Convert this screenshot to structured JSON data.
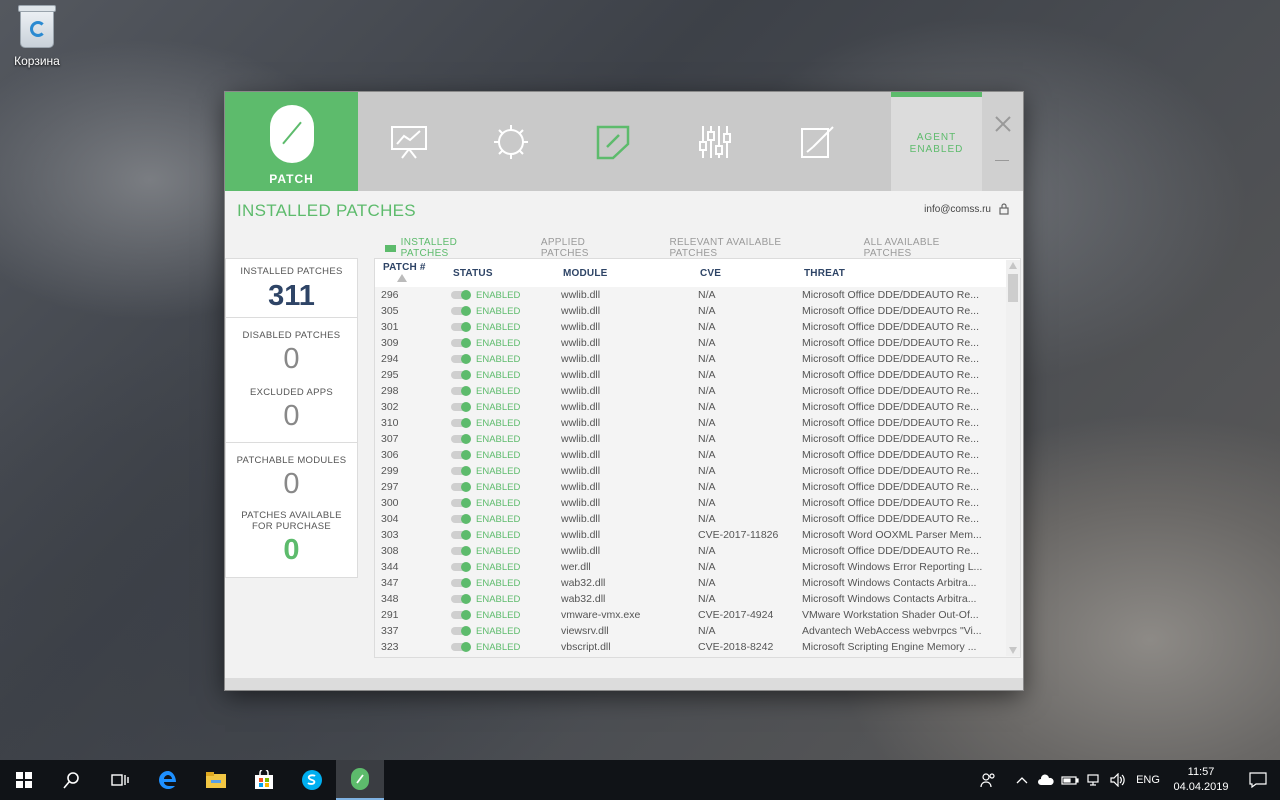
{
  "desktop": {
    "recycle_bin_label": "Корзина"
  },
  "app": {
    "logo_text": "PATCH",
    "agent_status_line1": "AGENT",
    "agent_status_line2": "ENABLED",
    "page_title": "INSTALLED PATCHES",
    "user_email": "info@comss.ru",
    "accent_color": "#5dbb6c",
    "nav_icons": [
      "dashboard-icon",
      "settings-gear-icon",
      "patch-shield-icon",
      "sliders-icon",
      "edit-icon"
    ],
    "tabs": [
      "INSTALLED PATCHES",
      "APPLIED PATCHES",
      "RELEVANT AVAILABLE PATCHES",
      "ALL AVAILABLE PATCHES"
    ],
    "active_tab": "INSTALLED PATCHES"
  },
  "stats": {
    "installed_label": "INSTALLED PATCHES",
    "installed_value": "311",
    "disabled_label": "DISABLED PATCHES",
    "disabled_value": "0",
    "excluded_label": "EXCLUDED APPS",
    "excluded_value": "0",
    "modules_label": "PATCHABLE MODULES",
    "modules_value": "0",
    "purchase_label_1": "PATCHES AVAILABLE",
    "purchase_label_2": "FOR PURCHASE",
    "purchase_value": "0"
  },
  "table": {
    "headers": [
      "PATCH #",
      "STATUS",
      "MODULE",
      "CVE",
      "THREAT"
    ],
    "rows": [
      [
        "296",
        "ENABLED",
        "wwlib.dll",
        "N/A",
        "Microsoft Office DDE/DDEAUTO Re..."
      ],
      [
        "305",
        "ENABLED",
        "wwlib.dll",
        "N/A",
        "Microsoft Office DDE/DDEAUTO Re..."
      ],
      [
        "301",
        "ENABLED",
        "wwlib.dll",
        "N/A",
        "Microsoft Office DDE/DDEAUTO Re..."
      ],
      [
        "309",
        "ENABLED",
        "wwlib.dll",
        "N/A",
        "Microsoft Office DDE/DDEAUTO Re..."
      ],
      [
        "294",
        "ENABLED",
        "wwlib.dll",
        "N/A",
        "Microsoft Office DDE/DDEAUTO Re..."
      ],
      [
        "295",
        "ENABLED",
        "wwlib.dll",
        "N/A",
        "Microsoft Office DDE/DDEAUTO Re..."
      ],
      [
        "298",
        "ENABLED",
        "wwlib.dll",
        "N/A",
        "Microsoft Office DDE/DDEAUTO Re..."
      ],
      [
        "302",
        "ENABLED",
        "wwlib.dll",
        "N/A",
        "Microsoft Office DDE/DDEAUTO Re..."
      ],
      [
        "310",
        "ENABLED",
        "wwlib.dll",
        "N/A",
        "Microsoft Office DDE/DDEAUTO Re..."
      ],
      [
        "307",
        "ENABLED",
        "wwlib.dll",
        "N/A",
        "Microsoft Office DDE/DDEAUTO Re..."
      ],
      [
        "306",
        "ENABLED",
        "wwlib.dll",
        "N/A",
        "Microsoft Office DDE/DDEAUTO Re..."
      ],
      [
        "299",
        "ENABLED",
        "wwlib.dll",
        "N/A",
        "Microsoft Office DDE/DDEAUTO Re..."
      ],
      [
        "297",
        "ENABLED",
        "wwlib.dll",
        "N/A",
        "Microsoft Office DDE/DDEAUTO Re..."
      ],
      [
        "300",
        "ENABLED",
        "wwlib.dll",
        "N/A",
        "Microsoft Office DDE/DDEAUTO Re..."
      ],
      [
        "304",
        "ENABLED",
        "wwlib.dll",
        "N/A",
        "Microsoft Office DDE/DDEAUTO Re..."
      ],
      [
        "303",
        "ENABLED",
        "wwlib.dll",
        "CVE-2017-11826",
        "Microsoft Word OOXML Parser Mem..."
      ],
      [
        "308",
        "ENABLED",
        "wwlib.dll",
        "N/A",
        "Microsoft Office DDE/DDEAUTO Re..."
      ],
      [
        "344",
        "ENABLED",
        "wer.dll",
        "N/A",
        "Microsoft Windows Error Reporting L..."
      ],
      [
        "347",
        "ENABLED",
        "wab32.dll",
        "N/A",
        "Microsoft Windows Contacts Arbitra..."
      ],
      [
        "348",
        "ENABLED",
        "wab32.dll",
        "N/A",
        "Microsoft Windows Contacts Arbitra..."
      ],
      [
        "291",
        "ENABLED",
        "vmware-vmx.exe",
        "CVE-2017-4924",
        "VMware Workstation Shader Out-Of..."
      ],
      [
        "337",
        "ENABLED",
        "viewsrv.dll",
        "N/A",
        "Advantech WebAccess webvrpcs \"Vi..."
      ],
      [
        "323",
        "ENABLED",
        "vbscript.dll",
        "CVE-2018-8242",
        "Microsoft Scripting Engine Memory ..."
      ]
    ]
  },
  "taskbar": {
    "apps": [
      "windows-start-icon",
      "search-icon",
      "task-view-icon",
      "edge-icon",
      "file-explorer-icon",
      "store-icon",
      "skype-icon",
      "patch-app-icon"
    ],
    "language": "ENG",
    "time": "11:57",
    "date": "04.04.2019"
  }
}
